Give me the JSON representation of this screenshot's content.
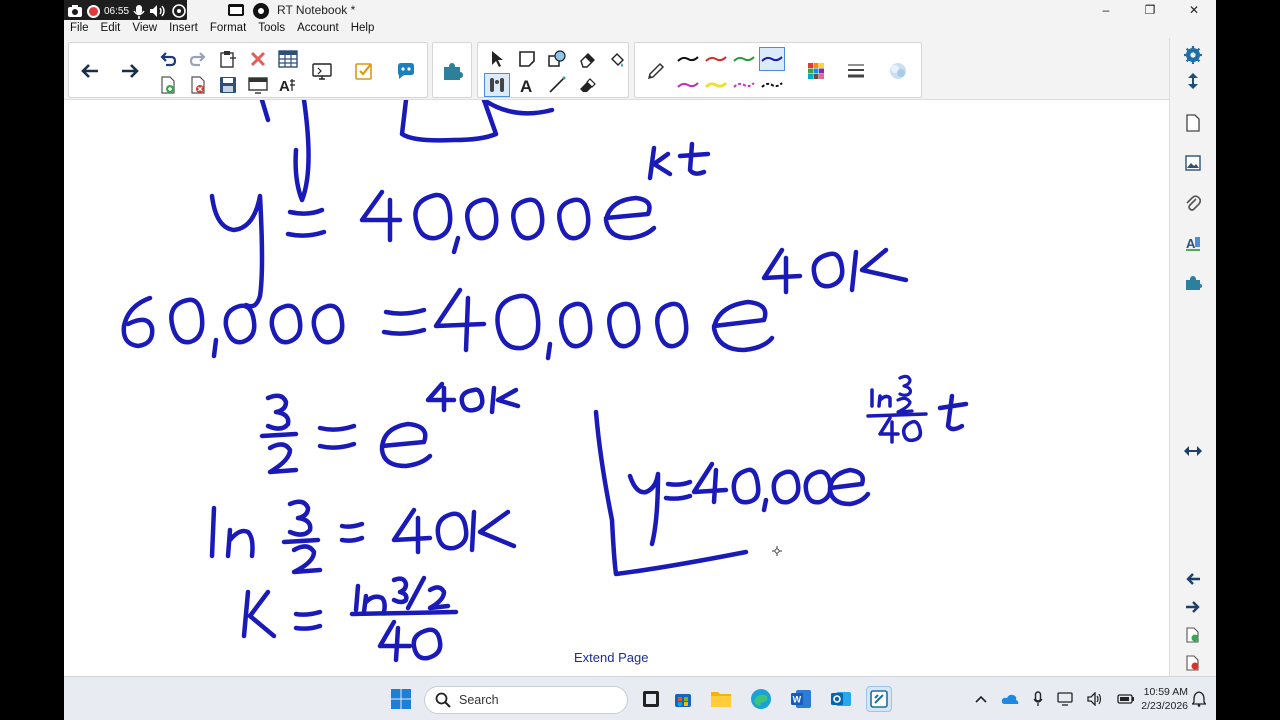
{
  "window": {
    "title": "RT Notebook *",
    "minimize": "–",
    "maximize": "❐",
    "close": "✕"
  },
  "recorder": {
    "time": "06:55"
  },
  "menu": [
    "File",
    "Edit",
    "View",
    "Insert",
    "Format",
    "Tools",
    "Account",
    "Help"
  ],
  "page": {
    "extend_label": "Extend Page",
    "ink_color": "#1a1ab8"
  },
  "taskbar": {
    "search_placeholder": "Search",
    "time": "10:59 AM",
    "date": "2/23/2026"
  },
  "colors": {
    "accent": "#4a8fd8",
    "ink": "#1a1ab8",
    "taskbar_bg": "#e8ecf2"
  }
}
